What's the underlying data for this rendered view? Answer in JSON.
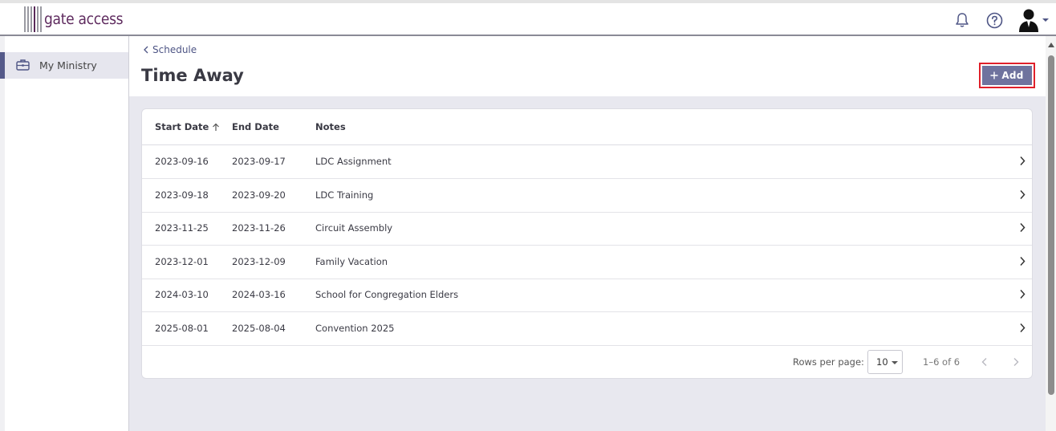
{
  "app": {
    "logo_text": "gate access"
  },
  "header": {
    "icons": [
      "bell-icon",
      "help-icon",
      "user-avatar-icon",
      "caret-down-icon"
    ]
  },
  "sidebar": {
    "items": [
      {
        "label": "My Ministry",
        "icon": "briefcase-icon",
        "active": true
      }
    ]
  },
  "page": {
    "breadcrumb": "Schedule",
    "title": "Time Away",
    "add_label": "Add"
  },
  "table": {
    "columns": [
      "Start Date",
      "End Date",
      "Notes"
    ],
    "sort": {
      "column": "Start Date",
      "direction": "ascending"
    },
    "rows": [
      {
        "start": "2023-09-16",
        "end": "2023-09-17",
        "notes": "LDC Assignment"
      },
      {
        "start": "2023-09-18",
        "end": "2023-09-20",
        "notes": "LDC Training"
      },
      {
        "start": "2023-11-25",
        "end": "2023-11-26",
        "notes": "Circuit Assembly"
      },
      {
        "start": "2023-12-01",
        "end": "2023-12-09",
        "notes": "Family Vacation"
      },
      {
        "start": "2024-03-10",
        "end": "2024-03-16",
        "notes": "School for Congregation Elders"
      },
      {
        "start": "2025-08-01",
        "end": "2025-08-04",
        "notes": "Convention 2025"
      }
    ]
  },
  "pagination": {
    "rows_per_page_label": "Rows per page:",
    "rows_per_page": "10",
    "range": "1–6 of 6"
  },
  "colors": {
    "accent": "#6f739e",
    "highlight_border": "#e0202a",
    "brand": "#5e2a5e",
    "content_bg": "#e8e8ef"
  }
}
